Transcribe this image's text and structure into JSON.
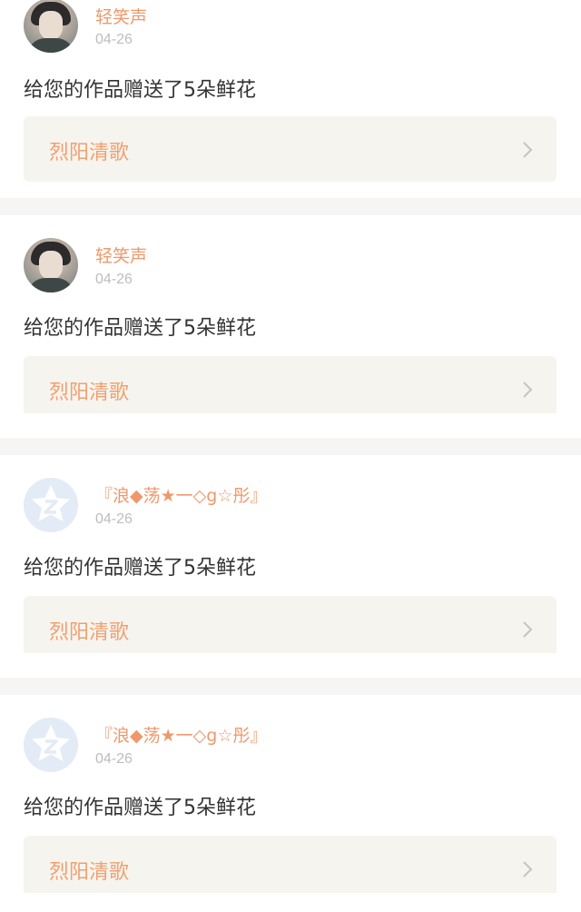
{
  "notifications": [
    {
      "username": "轻笑声",
      "date": "04-26",
      "avatar": "user-photo",
      "message": "给您的作品赠送了5朵鲜花",
      "work_title": "烈阳清歌"
    },
    {
      "username": "轻笑声",
      "date": "04-26",
      "avatar": "user-photo",
      "message": "给您的作品赠送了5朵鲜花",
      "work_title": "烈阳清歌"
    },
    {
      "username": "『浪◆荡★一◇g☆彤』",
      "date": "04-26",
      "avatar": "default-qzone-avatar",
      "message": "给您的作品赠送了5朵鲜花",
      "work_title": "烈阳清歌"
    },
    {
      "username": "『浪◆荡★一◇g☆彤』",
      "date": "04-26",
      "avatar": "default-qzone-avatar",
      "message": "给您的作品赠送了5朵鲜花",
      "work_title": "烈阳清歌"
    }
  ],
  "colors": {
    "username": "#f0986b",
    "date": "#bdbdbd",
    "message": "#333333",
    "work_title": "#f0a070",
    "work_link_bg": "#f6f4ee",
    "separator": "#f6f5f3",
    "default_avatar_bg": "#e3ebf6"
  },
  "icons": {
    "chevron": "chevron-right-icon",
    "default_avatar": "qzone-star-icon"
  }
}
